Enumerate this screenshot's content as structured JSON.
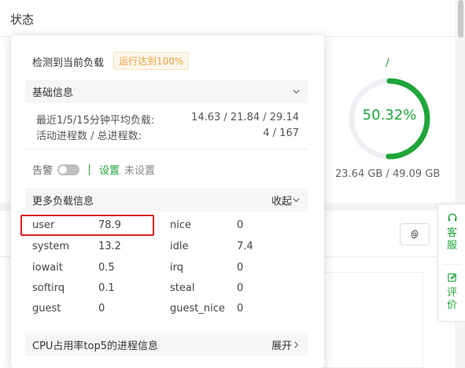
{
  "background": {
    "title": "状态",
    "disk": {
      "slash": "/",
      "percent": "50.32%",
      "percent_value": 50.32,
      "size": "23.64 GB / 49.09 GB"
    }
  },
  "side_float": {
    "service": "客服",
    "review": "评价"
  },
  "popover": {
    "title": "检测到当前负载",
    "badge": "运行达到100%",
    "basic_section": "基础信息",
    "load_label": "最近1/5/15分钟平均负载:",
    "load_value": "14.63 / 21.84 / 29.14",
    "proc_label": "活动进程数 / 总进程数:",
    "proc_value": "4 / 167",
    "alarm_label": "告警",
    "alarm_setting": "设置",
    "alarm_status": "未设置",
    "more_section": "更多负载信息",
    "collapse": "收起",
    "metrics": [
      {
        "name": "user",
        "value": "78.9"
      },
      {
        "name": "nice",
        "value": "0"
      },
      {
        "name": "system",
        "value": "13.2"
      },
      {
        "name": "idle",
        "value": "7.4"
      },
      {
        "name": "iowait",
        "value": "0.5"
      },
      {
        "name": "irq",
        "value": "0"
      },
      {
        "name": "softirq",
        "value": "0.1"
      },
      {
        "name": "steal",
        "value": "0"
      },
      {
        "name": "guest",
        "value": "0"
      },
      {
        "name": "guest_nice",
        "value": "0"
      }
    ],
    "top5_section": "CPU占用率top5的进程信息",
    "expand": "展开"
  },
  "colors": {
    "accent": "#20a53a",
    "warning": "#e6a23c",
    "highlight": "#e02020"
  }
}
